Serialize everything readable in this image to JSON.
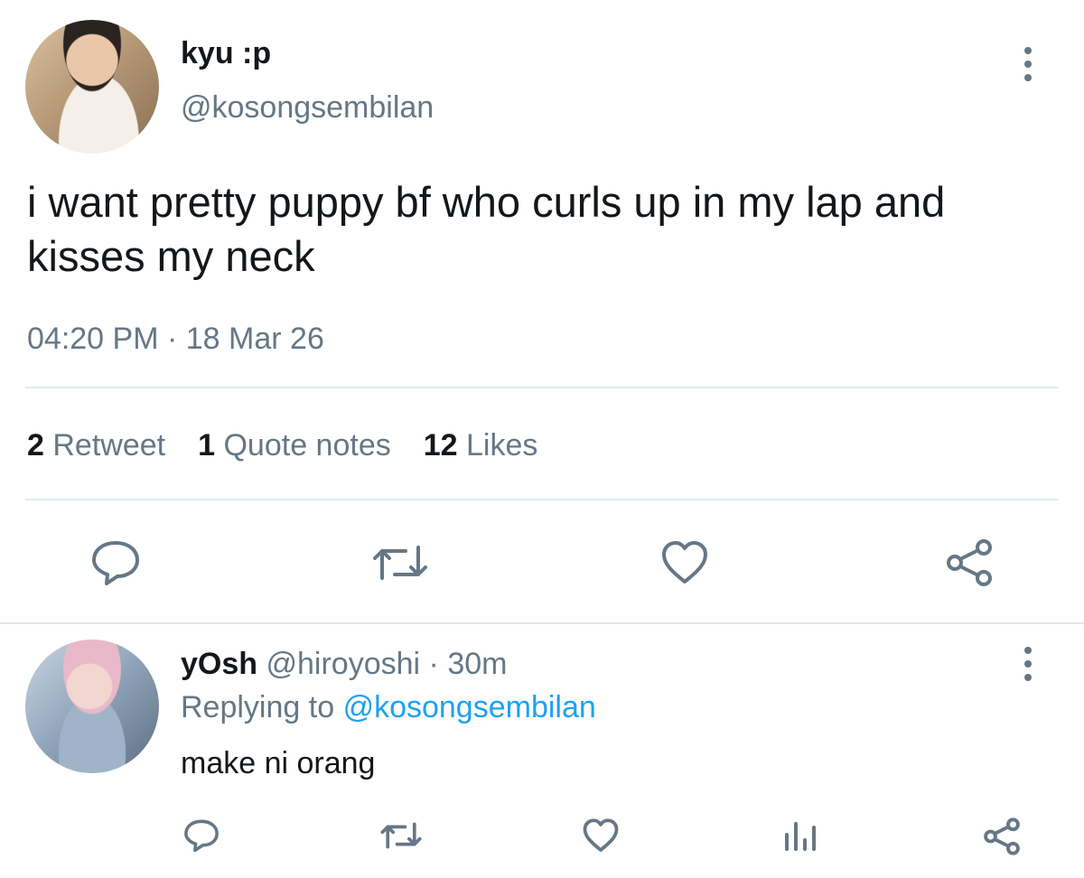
{
  "tweet": {
    "display_name": "kyu :p",
    "handle": "@kosongsembilan",
    "text": "i want pretty puppy bf who curls up in my lap and kisses my neck",
    "time": "04:20 PM",
    "separator": "·",
    "date": "18 Mar 26",
    "stats": [
      {
        "count": "2",
        "label": "Retweet"
      },
      {
        "count": "1",
        "label": "Quote notes"
      },
      {
        "count": "12",
        "label": "Likes"
      }
    ],
    "actions": [
      "reply-icon",
      "retweet-icon",
      "like-icon",
      "share-icon"
    ]
  },
  "reply": {
    "display_name": "yOsh",
    "handle": "@hiroyoshi",
    "separator": "·",
    "age": "30m",
    "replying_prefix": "Replying to",
    "replying_to": "@kosongsembilan",
    "text": "make ni orang",
    "actions": [
      "reply-icon",
      "retweet-icon",
      "like-icon",
      "analytics-icon",
      "share-icon"
    ]
  },
  "colors": {
    "text": "#14171a",
    "secondary": "#657786",
    "link": "#1da1f2",
    "divider": "#e1e8ed"
  }
}
